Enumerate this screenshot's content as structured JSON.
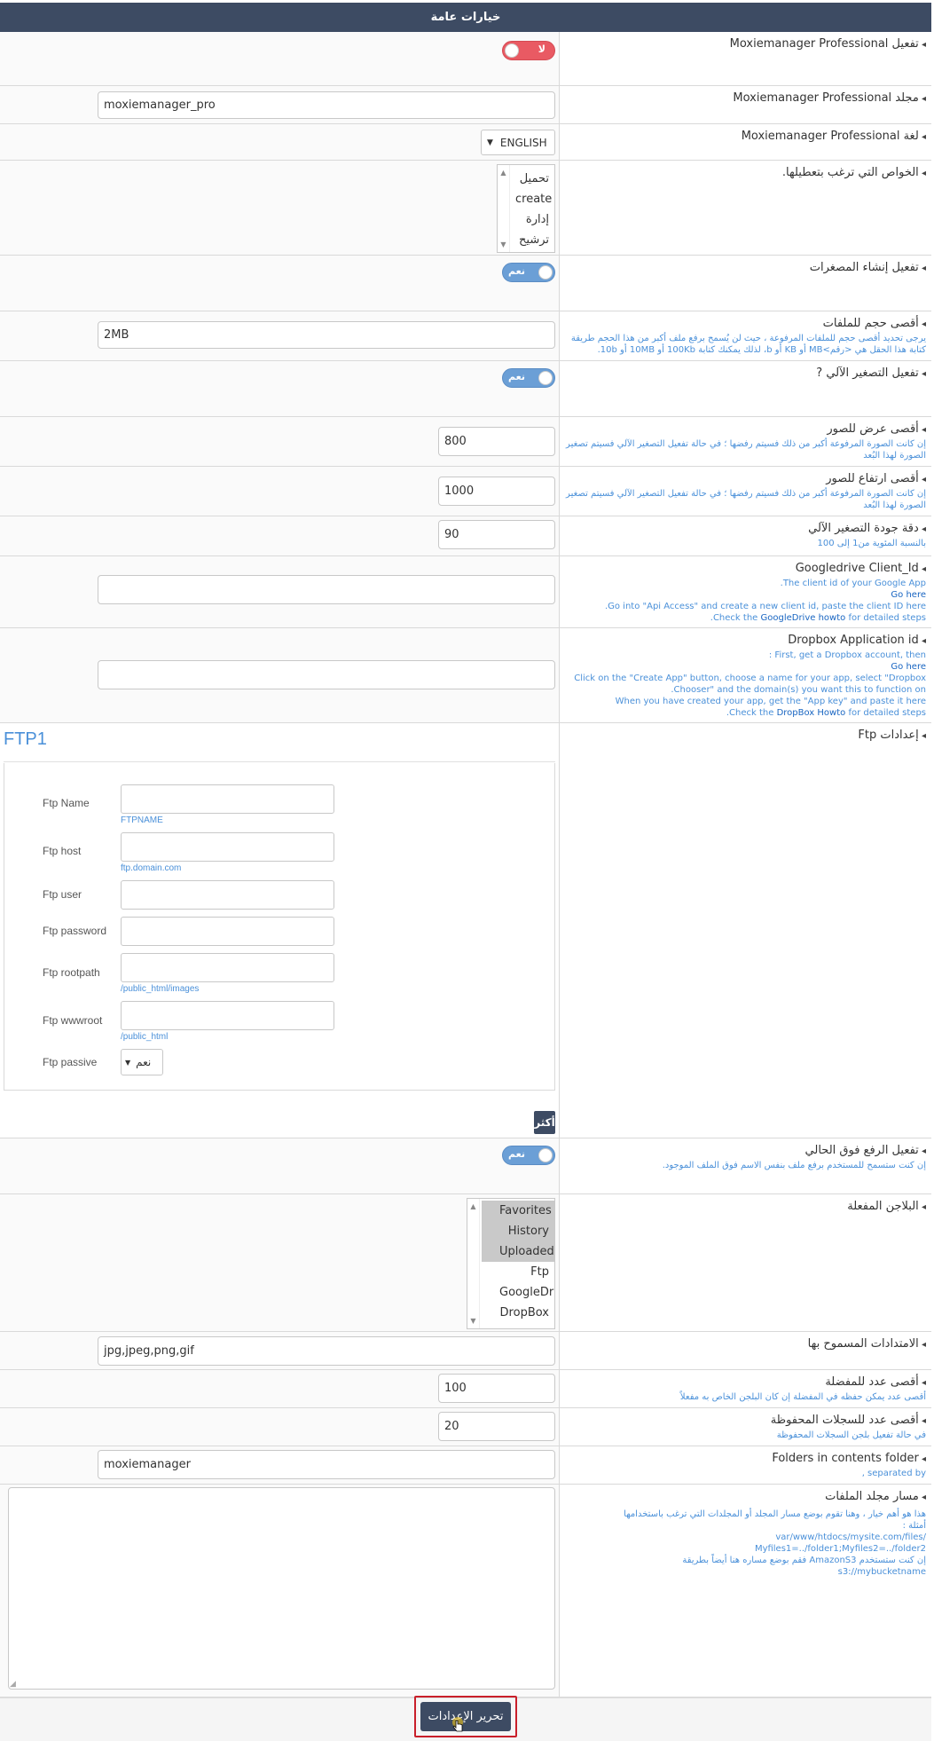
{
  "header": {
    "title": "خيارات عامة"
  },
  "rows": {
    "enable_pro": {
      "label": "تفعيل Moxiemanager Professional",
      "toggle": "لا"
    },
    "pro_folder": {
      "label": "مجلد Moxiemanager Professional",
      "value": "moxiemanager_pro"
    },
    "pro_lang": {
      "label": "لغة Moxiemanager Professional",
      "value": "ENGLISH"
    },
    "disabled_features": {
      "label": "الخواص التي ترغب بتعطيلها.",
      "options": [
        "تحميل",
        "create",
        "إدارة",
        "ترشيح"
      ]
    },
    "thumbnails": {
      "label": "تفعيل إنشاء المصغرات",
      "toggle": "نعم"
    },
    "max_size": {
      "label": "أقصى حجم للملفات",
      "desc": "يرجى تحديد أقصى حجم للملفات المرفوعة ، حيث لن يُسمح برفع ملف أكبر من هذا الحجم طريقة كتابة هذا الحقل هي <رقم>MB أو KB أو b، لذلك يمكنك كتابة 100Kb أو 10MB أو 10b.",
      "value": "2MB"
    },
    "autoresize": {
      "label": "تفعيل التصغير الآلي ?",
      "toggle": "نعم"
    },
    "max_width": {
      "label": "أقصى عرض للصور",
      "desc": "إن كانت الصورة المرفوعة أكبر من ذلك فسيتم رفضها ؛ في حالة تفعيل التصغير الآلي فسيتم تصغير الصورة لهذا البُعد",
      "value": "800"
    },
    "max_height": {
      "label": "أقصى ارتفاع للصور",
      "desc": "إن كانت الصورة المرفوعة أكبر من ذلك فسيتم رفضها ؛ في حالة تفعيل التصغير الآلي فسيتم تصغير الصورة لهذا البُعد",
      "value": "1000"
    },
    "quality": {
      "label": "دقة جودة التصغير الآلي",
      "desc": "بالنسبة المئوية من1 إلى 100",
      "value": "90"
    },
    "gdrive": {
      "label": "Googledrive Client_Id",
      "d1": "The client id of your Google App.",
      "d2": "Go here",
      "d3": "Go into \"Api Access\" and create a new client id, paste the client ID here.",
      "d4a": "Check the ",
      "d4b": "GoogleDrive howto",
      "d4c": " for detailed steps.",
      "value": ""
    },
    "dropbox": {
      "label": "Dropbox Application id",
      "d1": "First, get a Dropbox account, then :",
      "d2": "Go here",
      "d3": "Click on the \"Create App\" button, choose a name for your app, select \"Dropbox Chooser\" and the domain(s) you want this to function on.",
      "d4": "When you have created your app, get the \"App key\" and paste it here",
      "d5a": "Check the ",
      "d5b": "DropBox Howto",
      "d5c": " for detailed steps.",
      "value": ""
    },
    "ftp": {
      "label": "إعدادات Ftp",
      "title": "FTP1",
      "more": "أكثر",
      "fields": [
        {
          "label": "Ftp Name",
          "hint": "FTPNAME"
        },
        {
          "label": "Ftp host",
          "hint": "ftp.domain.com"
        },
        {
          "label": "Ftp user",
          "hint": ""
        },
        {
          "label": "Ftp password",
          "hint": ""
        },
        {
          "label": "Ftp rootpath",
          "hint": "/public_html/images"
        },
        {
          "label": "Ftp wwwroot",
          "hint": "/public_html"
        }
      ],
      "passive_label": "Ftp passive",
      "passive_value": "نعم"
    },
    "overwrite": {
      "label": "تفعيل الرفع فوق الحالي",
      "desc": "إن كنت ستسمح للمستخدم برفع ملف بنفس الاسم فوق الملف الموجود.",
      "toggle": "نعم"
    },
    "plugins": {
      "label": "البلاجن المفعلة",
      "options": [
        "Favorites",
        "History",
        "Uploaded",
        "Ftp",
        "GoogleDrive",
        "DropBox"
      ]
    },
    "extensions": {
      "label": "الامتدادات المسموح بها",
      "value": "jpg,jpeg,png,gif"
    },
    "max_fav": {
      "label": "أقصى عدد للمفضلة",
      "desc": "أقصى عدد يمكن حفظه في المفضلة إن كان البلجن الخاص به مفعلاً",
      "value": "100"
    },
    "max_hist": {
      "label": "أقصى عدد للسجلات المحفوظة",
      "desc": "في حالة تفعيل بلجن السجلات المحفوظة",
      "value": "20"
    },
    "folders": {
      "label": "Folders in contents folder",
      "desc": "separated by ,",
      "value": "moxiemanager"
    },
    "files_path": {
      "label": "مسار مجلد الملفات",
      "d1": "هذا هو أهم خيار ، وهنا تقوم بوضع مسار المجلد أو المجلدات التي ترغب باستخدامها",
      "d2": "أمثلة :",
      "d3": "/var/www/htdocs/mysite.com/files",
      "d4": "Myfiles1=../folder1;Myfiles2=../folder2",
      "d5": "إن كنت ستستخدم AmazonS3 فقم بوضع مساره هنا أيضاً بطريقة",
      "d6": "s3://mybucketname",
      "value": ""
    }
  },
  "submit": {
    "label": "تحرير الإعدادات"
  }
}
